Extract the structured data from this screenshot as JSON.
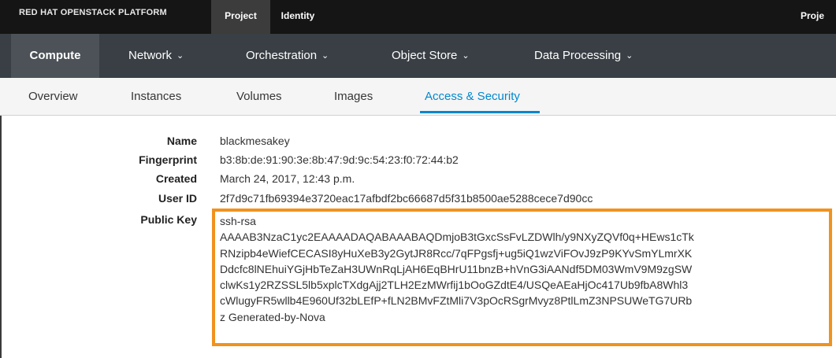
{
  "masthead": {
    "brand": "RED HAT OPENSTACK PLATFORM",
    "tabs": [
      "Project",
      "Identity"
    ],
    "right_text": "Proje"
  },
  "nav": {
    "items": [
      {
        "label": "Compute",
        "dropdown": false
      },
      {
        "label": "Network",
        "dropdown": true
      },
      {
        "label": "Orchestration",
        "dropdown": true
      },
      {
        "label": "Object Store",
        "dropdown": true
      },
      {
        "label": "Data Processing",
        "dropdown": true
      }
    ],
    "chevron": "⌄"
  },
  "tabs": [
    "Overview",
    "Instances",
    "Volumes",
    "Images",
    "Access & Security"
  ],
  "details": {
    "name_label": "Name",
    "name_value": "blackmesakey",
    "fingerprint_label": "Fingerprint",
    "fingerprint_value": "b3:8b:de:91:90:3e:8b:47:9d:9c:54:23:f0:72:44:b2",
    "created_label": "Created",
    "created_value": "March 24, 2017, 12:43 p.m.",
    "userid_label": "User ID",
    "userid_value": "2f7d9c71fb69394e3720eac17afbdf2bc66687d5f31b8500ae5288cece7d90cc",
    "publickey_label": "Public Key",
    "publickey_lines": [
      "ssh-rsa",
      "AAAAB3NzaC1yc2EAAAADAQABAAABAQDmjoB3tGxcSsFvLZDWlh/y9NXyZQVf0q+HEws1cTk",
      "RNzipb4eWiefCECASI8yHuXeB3y2GytJR8Rcc/7qFPgsfj+ug5iQ1wzViFOvJ9zP9KYvSmYLmrXK",
      "Ddcfc8lNEhuiYGjHbTeZaH3UWnRqLjAH6EqBHrU11bnzB+hVnG3iAANdf5DM03WmV9M9zgSW",
      "clwKs1y2RZSSL5lb5xplcTXdgAjj2TLH2EzMWrfij1bOoGZdtE4/USQeAEaHjOc417Ub9fbA8Whl3",
      "cWlugyFR5wllb4E960Uf32bLEfP+fLN2BMvFZtMli7V3pOcRSgrMvyz8PtlLmZ3NPSUWeTG7URb",
      "z Generated-by-Nova"
    ]
  },
  "colors": {
    "masthead_bg": "#151515",
    "nav_bg": "#393f44",
    "nav_active_bg": "#4d5258",
    "tab_active": "#0088ce",
    "highlight": "#f0921e"
  }
}
